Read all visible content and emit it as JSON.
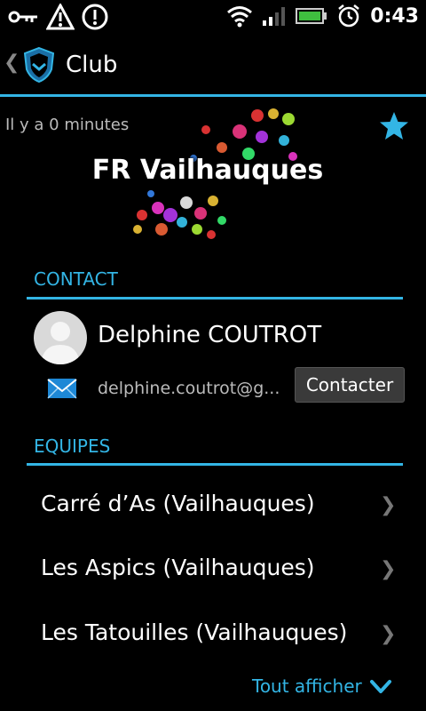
{
  "status_bar": {
    "time": "0:43"
  },
  "action_bar": {
    "title": "Club"
  },
  "club": {
    "updated": "Il y a 0 minutes",
    "name": "FR Vailhauques"
  },
  "contact": {
    "section_title": "CONTACT",
    "name": "Delphine COUTROT",
    "email": "delphine.coutrot@g...",
    "button_label": "Contacter"
  },
  "teams": {
    "section_title": "EQUIPES",
    "items": [
      {
        "label": "Carré d’As (Vailhauques)"
      },
      {
        "label": "Les Aspics (Vailhauques)"
      },
      {
        "label": "Les Tatouilles (Vailhauques)"
      }
    ],
    "show_all_label": "Tout afficher"
  },
  "colors": {
    "accent": "#33b5e5",
    "background": "#000000"
  }
}
